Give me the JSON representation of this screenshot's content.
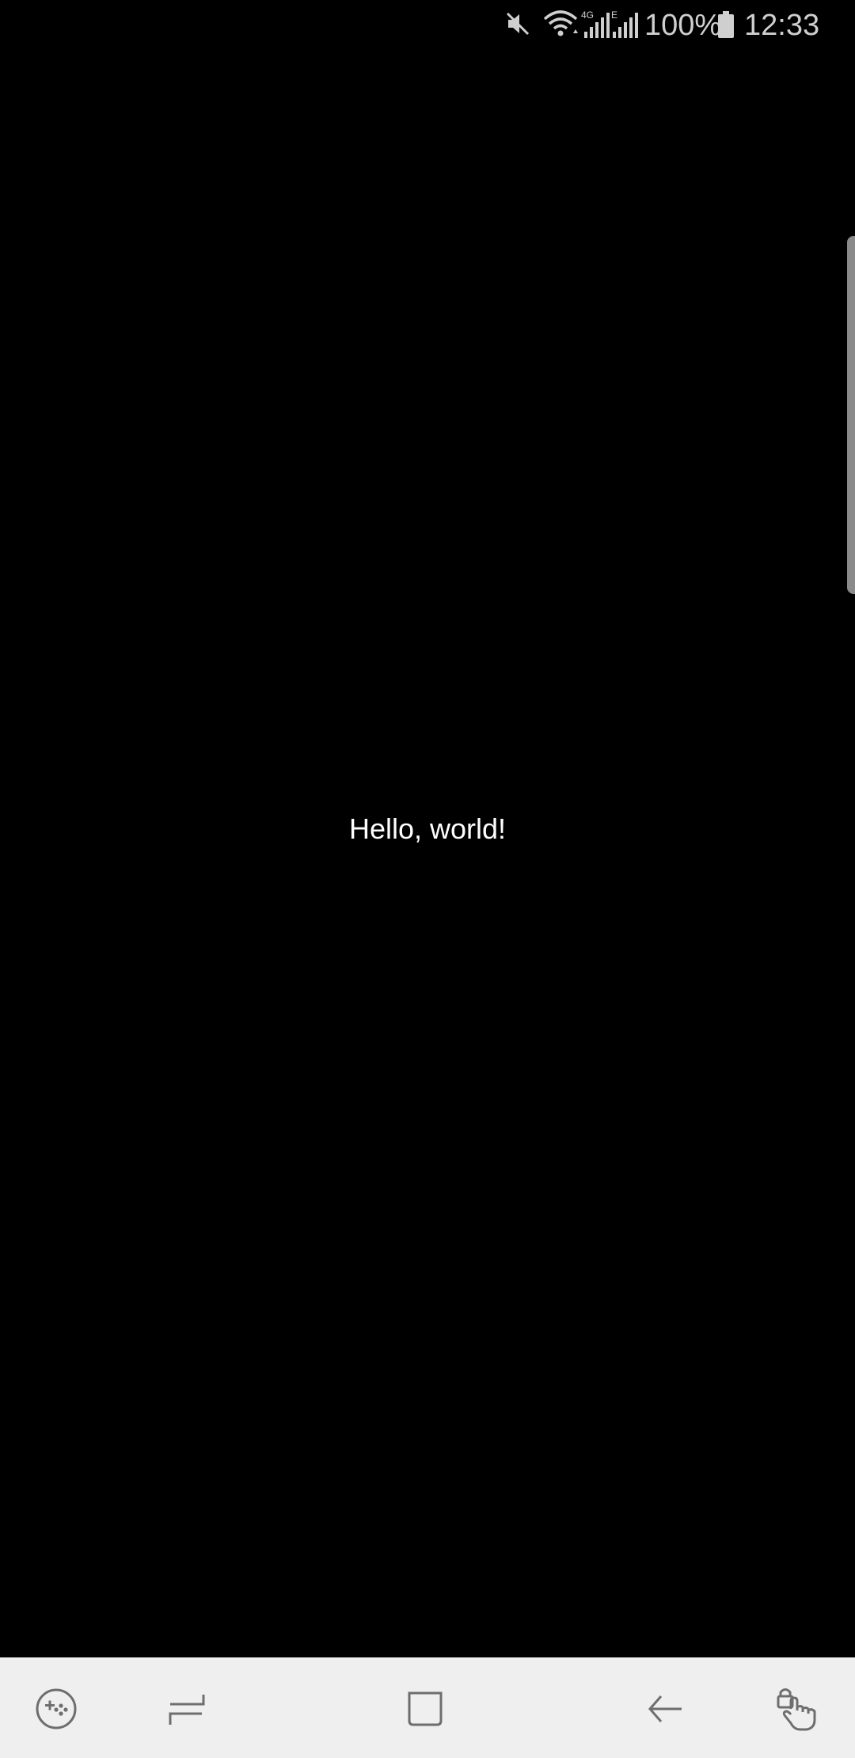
{
  "status_bar": {
    "battery_percent": "100%",
    "time": "12:33",
    "network_label_1": "4G",
    "network_label_2": "E",
    "icons": [
      "mute-icon",
      "wifi-icon",
      "signal-4g-icon",
      "signal-e-icon",
      "battery-icon"
    ]
  },
  "main": {
    "message": "Hello, world!"
  },
  "nav_bar": {
    "buttons": [
      "game-tools-button",
      "recents-button",
      "home-button",
      "back-button",
      "touch-protection-button"
    ]
  },
  "colors": {
    "background": "#000000",
    "status_text": "#cfcfcf",
    "nav_background": "#efefef",
    "nav_icon": "#6e6e6e"
  }
}
